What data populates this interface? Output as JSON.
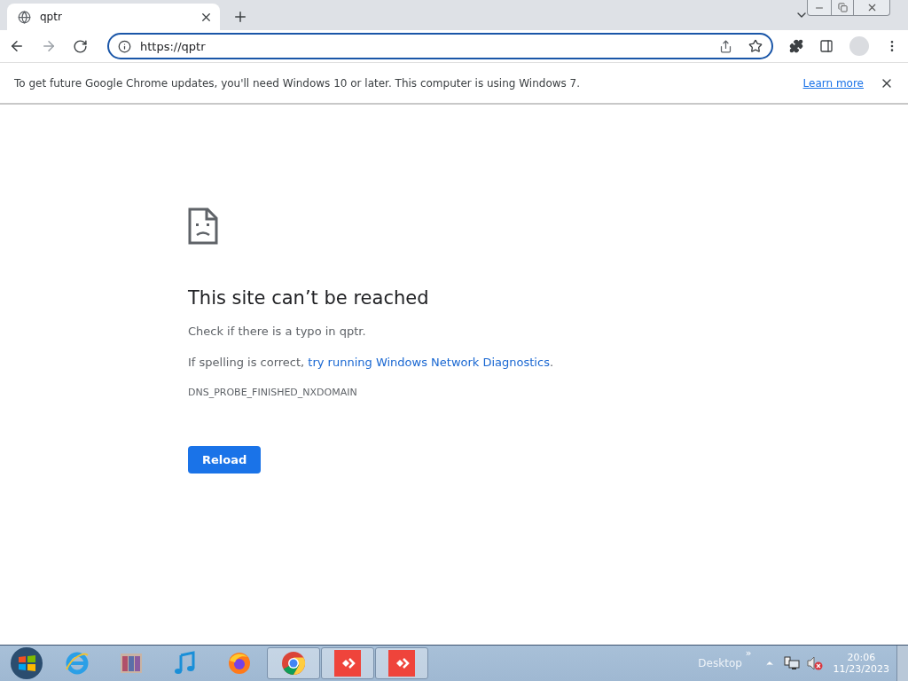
{
  "tab": {
    "title": "qptr",
    "selected": true
  },
  "address": {
    "value": "https://qptr"
  },
  "infobar": {
    "message": "To get future Google Chrome updates, you'll need Windows 10 or later. This computer is using Windows 7.",
    "link": "Learn more"
  },
  "error": {
    "title": "This site can’t be reached",
    "line_1": "Check if there is a typo in qptr.",
    "line_2_prefix": "If spelling is correct, ",
    "line_2_link": "try running Windows Network Diagnostics",
    "line_2_suffix": ".",
    "code": "DNS_PROBE_FINISHED_NXDOMAIN",
    "button": "Reload"
  },
  "taskbar": {
    "apps": [
      {
        "kind": "start",
        "running": false
      },
      {
        "kind": "ie",
        "running": false
      },
      {
        "kind": "archive",
        "running": false
      },
      {
        "kind": "music",
        "running": false
      },
      {
        "kind": "firefox",
        "running": false
      },
      {
        "kind": "chrome",
        "running": true
      },
      {
        "kind": "remote",
        "running": true
      },
      {
        "kind": "remote",
        "running": true
      }
    ],
    "toolbar_label": "Desktop",
    "toolbar_chevron": "»",
    "time": "20:06",
    "date": "11/23/2023"
  }
}
